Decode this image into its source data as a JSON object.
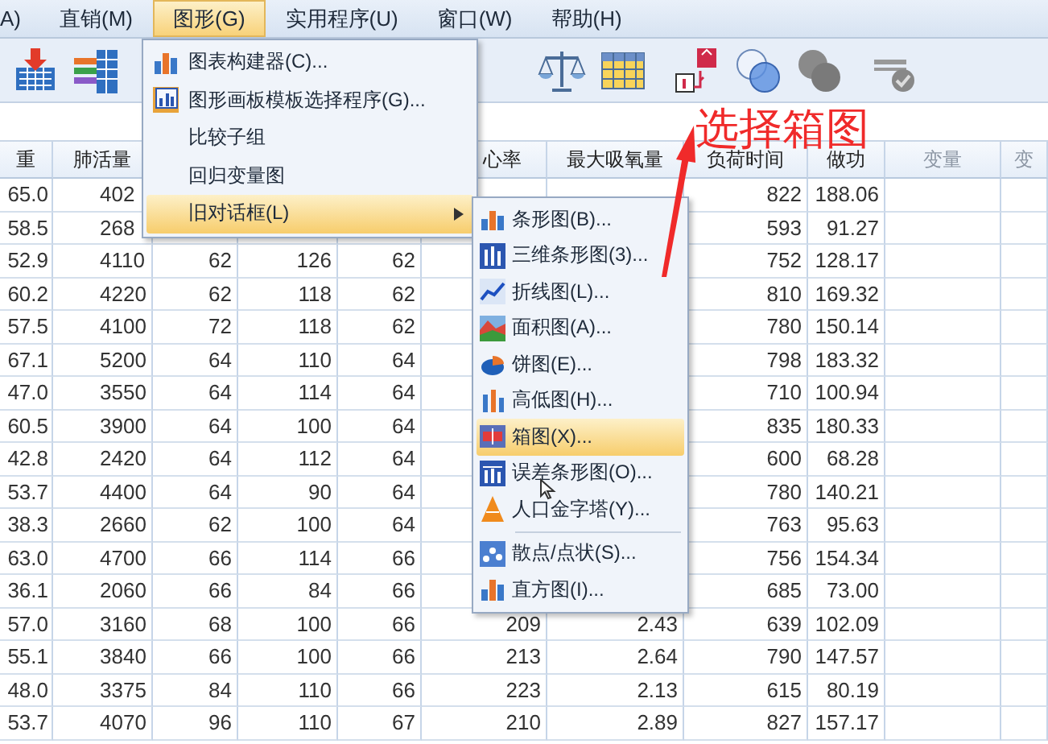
{
  "menu_bar": [
    {
      "label": "A)",
      "selected": false
    },
    {
      "label": "直销(M)",
      "selected": false
    },
    {
      "label": "图形(G)",
      "selected": true
    },
    {
      "label": "实用程序(U)",
      "selected": false
    },
    {
      "label": "窗口(W)",
      "selected": false
    },
    {
      "label": "帮助(H)",
      "selected": false
    }
  ],
  "table": {
    "columns": [
      "重",
      "肺活量",
      null,
      null,
      null,
      "心率",
      "最大吸氧量",
      "负荷时间",
      "做功"
    ],
    "empty_columns": [
      "变量",
      "变"
    ],
    "rows": [
      [
        "65.0",
        "402",
        null,
        null,
        null,
        null,
        null,
        "822",
        "188.06"
      ],
      [
        "58.5",
        "268",
        null,
        null,
        null,
        null,
        null,
        "593",
        "91.27"
      ],
      [
        "52.9",
        "4110",
        "62",
        "126",
        "62",
        null,
        null,
        "752",
        "128.17"
      ],
      [
        "60.2",
        "4220",
        "62",
        "118",
        "62",
        null,
        null,
        "810",
        "169.32"
      ],
      [
        "57.5",
        "4100",
        "72",
        "118",
        "62",
        null,
        null,
        "780",
        "150.14"
      ],
      [
        "67.1",
        "5200",
        "64",
        "110",
        "64",
        null,
        null,
        "798",
        "183.32"
      ],
      [
        "47.0",
        "3550",
        "64",
        "114",
        "64",
        null,
        null,
        "710",
        "100.94"
      ],
      [
        "60.5",
        "3900",
        "64",
        "100",
        "64",
        null,
        null,
        "835",
        "180.33"
      ],
      [
        "42.8",
        "2420",
        "64",
        "112",
        "64",
        null,
        null,
        "600",
        "68.28"
      ],
      [
        "53.7",
        "4400",
        "64",
        "90",
        "64",
        null,
        null,
        "780",
        "140.21"
      ],
      [
        "38.3",
        "2660",
        "62",
        "100",
        "64",
        null,
        null,
        "763",
        "95.63"
      ],
      [
        "63.0",
        "4700",
        "66",
        "114",
        "66",
        null,
        null,
        "756",
        "154.34"
      ],
      [
        "36.1",
        "2060",
        "66",
        "84",
        "66",
        null,
        null,
        "685",
        "73.00"
      ],
      [
        "57.0",
        "3160",
        "68",
        "100",
        "66",
        "209",
        "2.43",
        "639",
        "102.09"
      ],
      [
        "55.1",
        "3840",
        "66",
        "100",
        "66",
        "213",
        "2.64",
        "790",
        "147.57"
      ],
      [
        "48.0",
        "3375",
        "84",
        "110",
        "66",
        "223",
        "2.13",
        "615",
        "80.19"
      ],
      [
        "53.7",
        "4070",
        "96",
        "110",
        "67",
        "210",
        "2.89",
        "827",
        "157.17"
      ]
    ]
  },
  "graphs_menu": {
    "items": [
      {
        "label": "图表构建器(C)...",
        "kind": "icon",
        "selected": false,
        "has_submenu": false
      },
      {
        "label": "图形画板模板选择程序(G)...",
        "kind": "icon",
        "selected": false,
        "has_submenu": false
      },
      {
        "label": "比较子组",
        "kind": "plain",
        "selected": false,
        "has_submenu": false
      },
      {
        "label": "回归变量图",
        "kind": "plain",
        "selected": false,
        "has_submenu": false
      },
      {
        "label": "旧对话框(L)",
        "kind": "plain",
        "selected": true,
        "has_submenu": true
      }
    ]
  },
  "legacy_submenu": {
    "items": [
      {
        "label": "条形图(B)...",
        "selected": false,
        "separator_before": false
      },
      {
        "label": "三维条形图(3)...",
        "selected": false,
        "separator_before": false
      },
      {
        "label": "折线图(L)...",
        "selected": false,
        "separator_before": false
      },
      {
        "label": "面积图(A)...",
        "selected": false,
        "separator_before": false
      },
      {
        "label": "饼图(E)...",
        "selected": false,
        "separator_before": false
      },
      {
        "label": "高低图(H)...",
        "selected": false,
        "separator_before": false
      },
      {
        "label": "箱图(X)...",
        "selected": true,
        "separator_before": false
      },
      {
        "label": "误差条形图(O)...",
        "selected": false,
        "separator_before": false
      },
      {
        "label": "人口金字塔(Y)...",
        "selected": false,
        "separator_before": false
      },
      {
        "label": "散点/点状(S)...",
        "selected": false,
        "separator_before": true
      },
      {
        "label": "直方图(I)...",
        "selected": false,
        "separator_before": false
      }
    ]
  },
  "annotation": {
    "text": "选择箱图"
  }
}
